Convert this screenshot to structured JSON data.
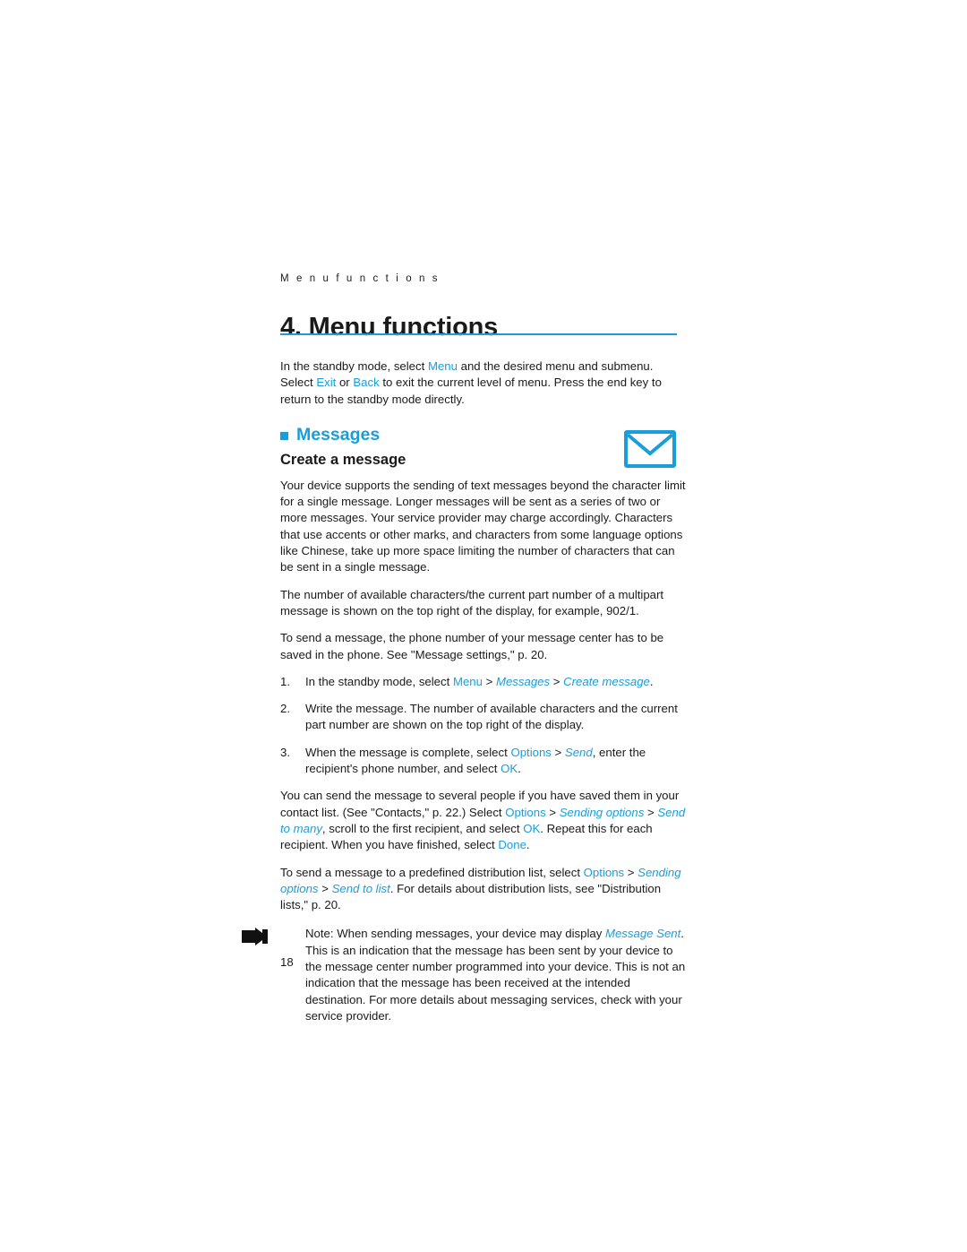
{
  "header": {
    "running_head": "M e n u   f u n c t i o n s"
  },
  "chapter": {
    "title": "4.  Menu functions"
  },
  "intro": {
    "part1": "In the standby mode, select ",
    "menu": "Menu",
    "part2": " and the desired menu and submenu. Select ",
    "exit": "Exit",
    "part3": " or ",
    "back": "Back",
    "part4": " to exit the current level of menu. Press the end key to return to the standby mode directly."
  },
  "section": {
    "heading": "Messages",
    "subheading": "Create a message"
  },
  "paragraphs": {
    "p1": "Your device supports the sending of text messages beyond the character limit for a single message. Longer messages will be sent as a series of two or more messages. Your service provider may charge accordingly. Characters that use accents or other marks, and characters from some language options like Chinese, take up more space limiting the number of characters that can be sent in a single message.",
    "p2": "The number of available characters/the current part number of a multipart message is shown on the top right of the display, for example, 902/1.",
    "p3": "To send a message, the phone number of your message center has to be saved in the phone. See \"Message settings,\" p. 20."
  },
  "steps": [
    {
      "num": "1.",
      "seg": [
        {
          "t": "In the standby mode, select ",
          "s": "plain"
        },
        {
          "t": "Menu",
          "s": "blue"
        },
        {
          "t": " > ",
          "s": "plain"
        },
        {
          "t": "Messages",
          "s": "blue-it"
        },
        {
          "t": " > ",
          "s": "plain"
        },
        {
          "t": "Create message",
          "s": "blue-it"
        },
        {
          "t": ".",
          "s": "plain"
        }
      ]
    },
    {
      "num": "2.",
      "seg": [
        {
          "t": "Write the message. The number of available characters and the current part number are shown on the top right of the display.",
          "s": "plain"
        }
      ]
    },
    {
      "num": "3.",
      "seg": [
        {
          "t": "When the message is complete, select ",
          "s": "plain"
        },
        {
          "t": "Options",
          "s": "blue"
        },
        {
          "t": " > ",
          "s": "plain"
        },
        {
          "t": "Send",
          "s": "blue-it"
        },
        {
          "t": ", enter the recipient's phone number, and select ",
          "s": "plain"
        },
        {
          "t": "OK",
          "s": "blue"
        },
        {
          "t": ".",
          "s": "plain"
        }
      ]
    }
  ],
  "sub_paragraphs": [
    {
      "seg": [
        {
          "t": "You can send the message to several people if you have saved them in your contact list. (See \"Contacts,\" p. 22.) Select ",
          "s": "plain"
        },
        {
          "t": "Options",
          "s": "blue"
        },
        {
          "t": " > ",
          "s": "plain"
        },
        {
          "t": "Sending options",
          "s": "blue-it"
        },
        {
          "t": " > ",
          "s": "plain"
        },
        {
          "t": "Send to many",
          "s": "blue-it"
        },
        {
          "t": ", scroll to the first recipient, and select ",
          "s": "plain"
        },
        {
          "t": "OK",
          "s": "blue"
        },
        {
          "t": ". Repeat this for each recipient. When you have finished, select ",
          "s": "plain"
        },
        {
          "t": "Done",
          "s": "blue"
        },
        {
          "t": ".",
          "s": "plain"
        }
      ]
    },
    {
      "seg": [
        {
          "t": "To send a message to a predefined distribution list, select ",
          "s": "plain"
        },
        {
          "t": "Options",
          "s": "blue"
        },
        {
          "t": " > ",
          "s": "plain"
        },
        {
          "t": "Sending options",
          "s": "blue-it"
        },
        {
          "t": " > ",
          "s": "plain"
        },
        {
          "t": "Send to list",
          "s": "blue-it"
        },
        {
          "t": ". For details about distribution lists, see \"Distribution lists,\" p. 20.",
          "s": "plain"
        }
      ]
    }
  ],
  "note": {
    "seg": [
      {
        "t": "Note: ",
        "s": "plain"
      },
      {
        "t": "When sending messages, your device may display ",
        "s": "plain"
      },
      {
        "t": "Message Sent",
        "s": "blue-it"
      },
      {
        "t": ". This is an indication that the message has been sent by your device to the message center number programmed into your device. This is not an indication that the message has been received at the intended destination. For more details about messaging services, check with your service provider.",
        "s": "plain"
      }
    ]
  },
  "footer": {
    "page_number": "18"
  },
  "icons": {
    "envelope": "envelope-icon",
    "note_hand": "pointing-hand-icon",
    "bullet": "square-bullet-icon"
  },
  "colors": {
    "accent": "#1a9ed9",
    "text": "#1a1a1a",
    "background": "#ffffff"
  }
}
